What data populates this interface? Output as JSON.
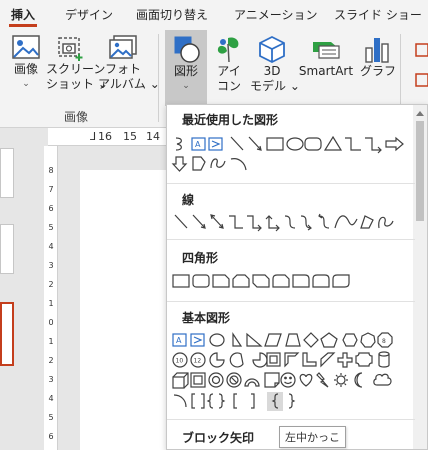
{
  "tabs": [
    "挿入",
    "デザイン",
    "画面切り替え",
    "アニメーション",
    "スライド ショー"
  ],
  "ribbon": {
    "image": {
      "line1": "画像",
      "line2": "⌄"
    },
    "screenshot": {
      "line1": "スクリーン",
      "line2": "ショット ⌄"
    },
    "photoalbum": {
      "line1": "フォト",
      "line2": "アルバム ⌄"
    },
    "shapes": {
      "line1": "図形",
      "line2": "⌄"
    },
    "icons": {
      "line1": "アイ",
      "line2": "コン"
    },
    "model3d": {
      "line1": "3D",
      "line2": "モデル ⌄"
    },
    "smartart": {
      "line1": "SmartArt"
    },
    "graph": {
      "line1": "グラフ"
    },
    "group_label": "画像"
  },
  "ruler": {
    "h_labels": [
      "16",
      "15",
      "14"
    ],
    "v_labels": [
      "8",
      "7",
      "6",
      "5",
      "4",
      "3",
      "2",
      "1",
      "0",
      "1",
      "2",
      "3",
      "4",
      "5",
      "6"
    ]
  },
  "panel": {
    "sections": {
      "recent": "最近使用した図形",
      "lines": "線",
      "rect": "四角形",
      "basic": "基本図形",
      "block": "ブロック矢印"
    }
  },
  "tooltip": "左中かっこ",
  "colors": {
    "accent": "#c43e1c",
    "shape_stroke": "#404040",
    "shape_blue": "#2f6fc6"
  }
}
